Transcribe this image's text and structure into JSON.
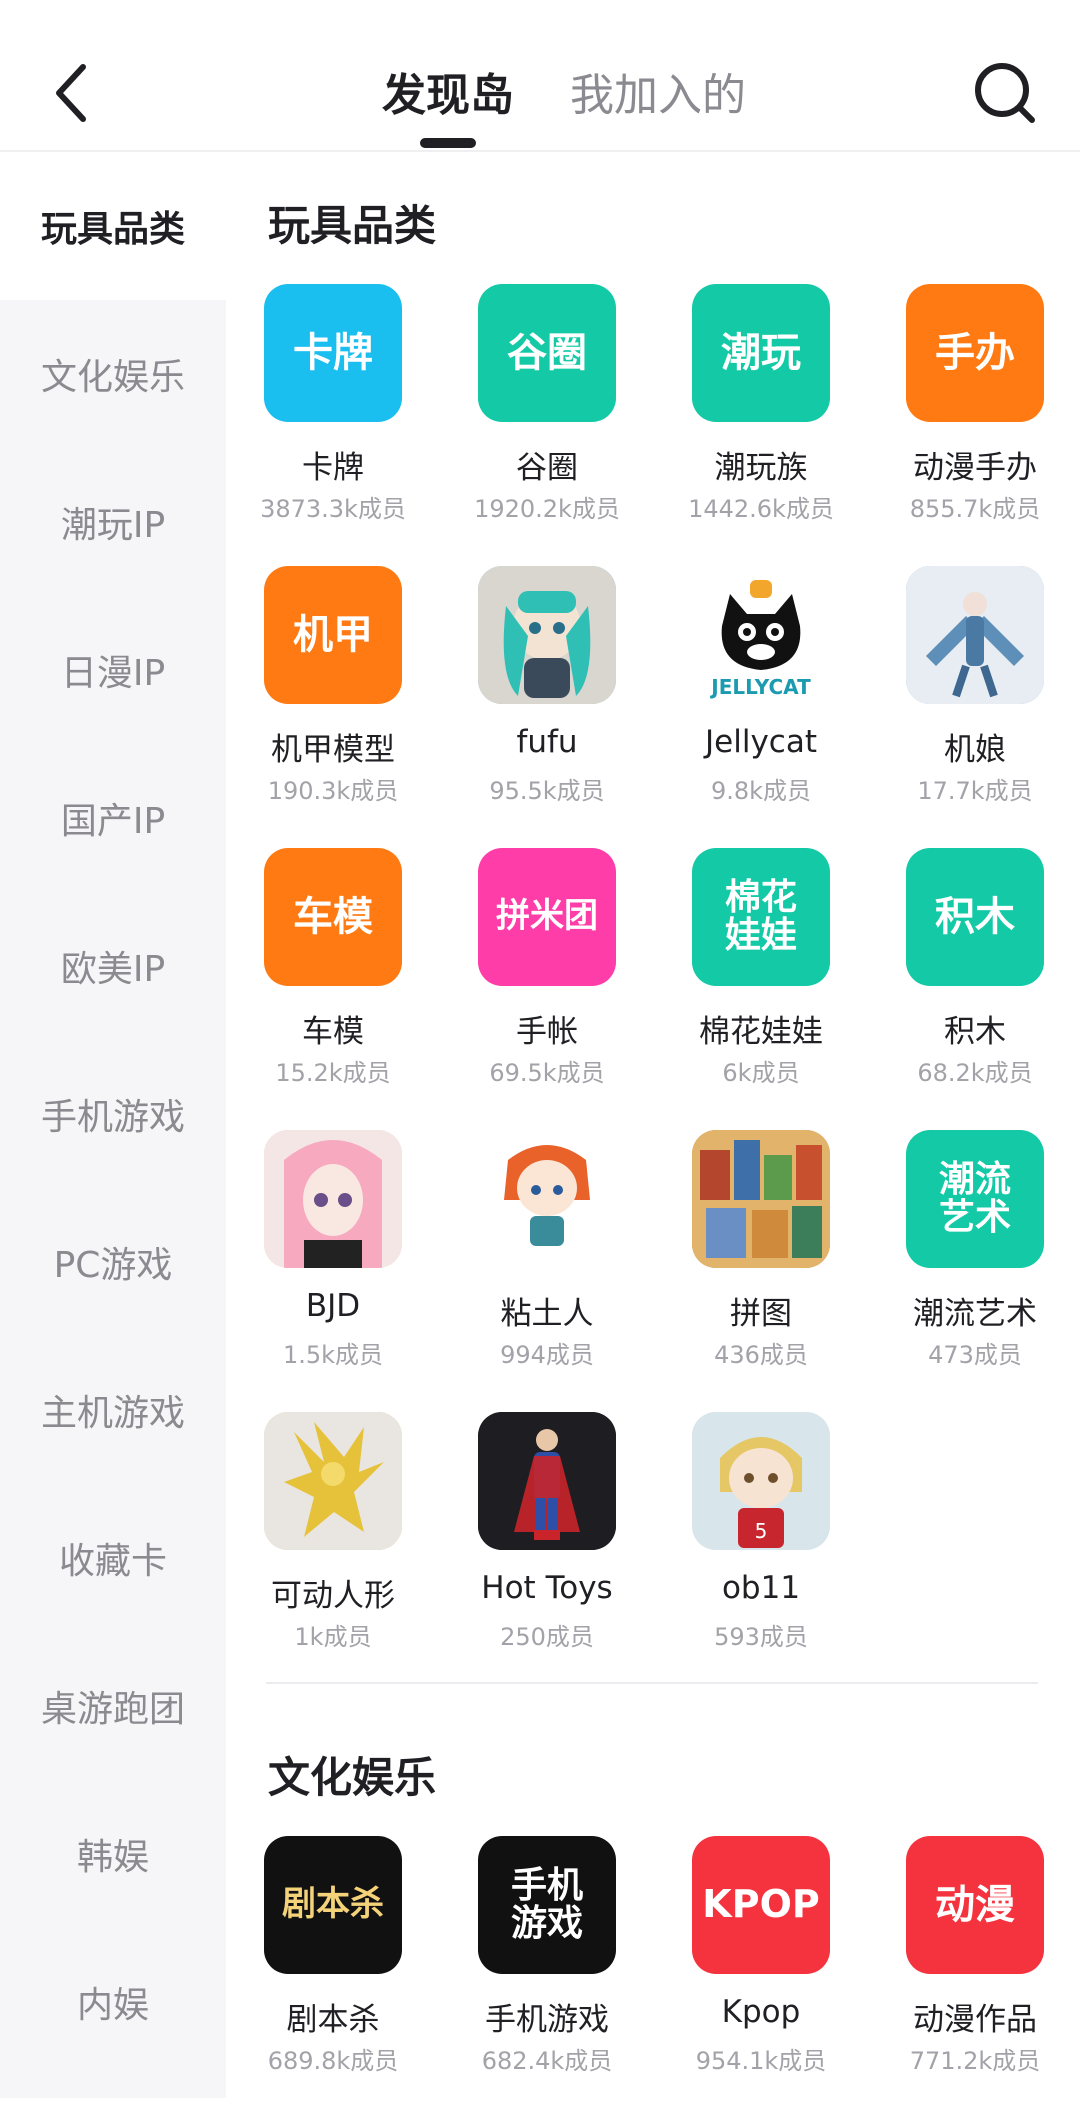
{
  "header": {
    "tabs": [
      {
        "label": "发现岛",
        "active": true
      },
      {
        "label": "我加入的",
        "active": false
      }
    ]
  },
  "sidebar": {
    "items": [
      {
        "label": "玩具品类",
        "active": true
      },
      {
        "label": "文化娱乐"
      },
      {
        "label": "潮玩IP"
      },
      {
        "label": "日漫IP"
      },
      {
        "label": "国产IP"
      },
      {
        "label": "欧美IP"
      },
      {
        "label": "手机游戏"
      },
      {
        "label": "PC游戏"
      },
      {
        "label": "主机游戏"
      },
      {
        "label": "收藏卡"
      },
      {
        "label": "桌游跑团"
      },
      {
        "label": "韩娱"
      },
      {
        "label": "内娱"
      }
    ]
  },
  "sections": [
    {
      "title": "玩具品类",
      "groups": [
        {
          "name": "卡牌",
          "members": "3873.3k成员",
          "icon_text": "卡牌",
          "color": "#1ABEEF",
          "icon": "text-badge"
        },
        {
          "name": "谷圈",
          "members": "1920.2k成员",
          "icon_text": "谷圈",
          "color": "#14C9A6",
          "icon": "text-badge"
        },
        {
          "name": "潮玩族",
          "members": "1442.6k成员",
          "icon_text": "潮玩",
          "color": "#14C9A6",
          "icon": "text-badge"
        },
        {
          "name": "动漫手办",
          "members": "855.7k成员",
          "icon_text": "手办",
          "color": "#FF7A12",
          "icon": "text-badge"
        },
        {
          "name": "机甲模型",
          "members": "190.3k成员",
          "icon_text": "机甲",
          "color": "#FF7A12",
          "icon": "text-badge"
        },
        {
          "name": "fufu",
          "members": "95.5k成员",
          "color": "#6FC9C0",
          "icon": "plush-doll-photo"
        },
        {
          "name": "Jellycat",
          "members": "9.8k成员",
          "color": "#ffffff",
          "icon": "jellycat-cat-logo"
        },
        {
          "name": "机娘",
          "members": "17.7k成员",
          "color": "#8FB6D6",
          "icon": "mecha-girl-figure-photo"
        },
        {
          "name": "车模",
          "members": "15.2k成员",
          "icon_text": "车模",
          "color": "#FF7A12",
          "icon": "text-badge"
        },
        {
          "name": "手帐",
          "members": "69.5k成员",
          "icon_text": "拼米团",
          "color": "#FF3DA8",
          "icon": "text-badge"
        },
        {
          "name": "棉花娃娃",
          "members": "6k成员",
          "icon_text": "棉花娃娃",
          "color": "#14C9A6",
          "icon": "text-badge"
        },
        {
          "name": "积木",
          "members": "68.2k成员",
          "icon_text": "积木",
          "color": "#14C9A6",
          "icon": "text-badge"
        },
        {
          "name": "BJD",
          "members": "1.5k成员",
          "color": "#F2C6D0",
          "icon": "bjd-doll-photo"
        },
        {
          "name": "粘土人",
          "members": "994成员",
          "color": "#ffffff",
          "icon": "nendoroid-figure-photo"
        },
        {
          "name": "拼图",
          "members": "436成员",
          "color": "#C98A3B",
          "icon": "jigsaw-puzzle-photo"
        },
        {
          "name": "潮流艺术",
          "members": "473成员",
          "icon_text": "潮流艺术",
          "color": "#14C9A6",
          "icon": "text-badge"
        },
        {
          "name": "可动人形",
          "members": "1k成员",
          "color": "#D9C06A",
          "icon": "gold-armor-figure-photo"
        },
        {
          "name": "Hot Toys",
          "members": "250成员",
          "color": "#2A2A2E",
          "icon": "superhero-figure-photo"
        },
        {
          "name": "ob11",
          "members": "593成员",
          "color": "#CFE2EA",
          "icon": "ob11-doll-photo"
        }
      ]
    },
    {
      "title": "文化娱乐",
      "groups": [
        {
          "name": "剧本杀",
          "members": "689.8k成员",
          "icon_text": "剧本杀",
          "color": "#111111",
          "text_color": "#F4D27A",
          "icon": "text-badge"
        },
        {
          "name": "手机游戏",
          "members": "682.4k成员",
          "icon_text": "手机游戏",
          "color": "#111111",
          "icon": "text-badge"
        },
        {
          "name": "Kpop",
          "members": "954.1k成员",
          "icon_text": "KPOP",
          "color": "#F5333F",
          "icon": "text-badge"
        },
        {
          "name": "动漫作品",
          "members": "771.2k成员",
          "icon_text": "动漫",
          "color": "#F5333F",
          "icon": "text-badge"
        }
      ]
    }
  ],
  "icons": {
    "back": "chevron-left-icon",
    "search": "search-icon"
  }
}
